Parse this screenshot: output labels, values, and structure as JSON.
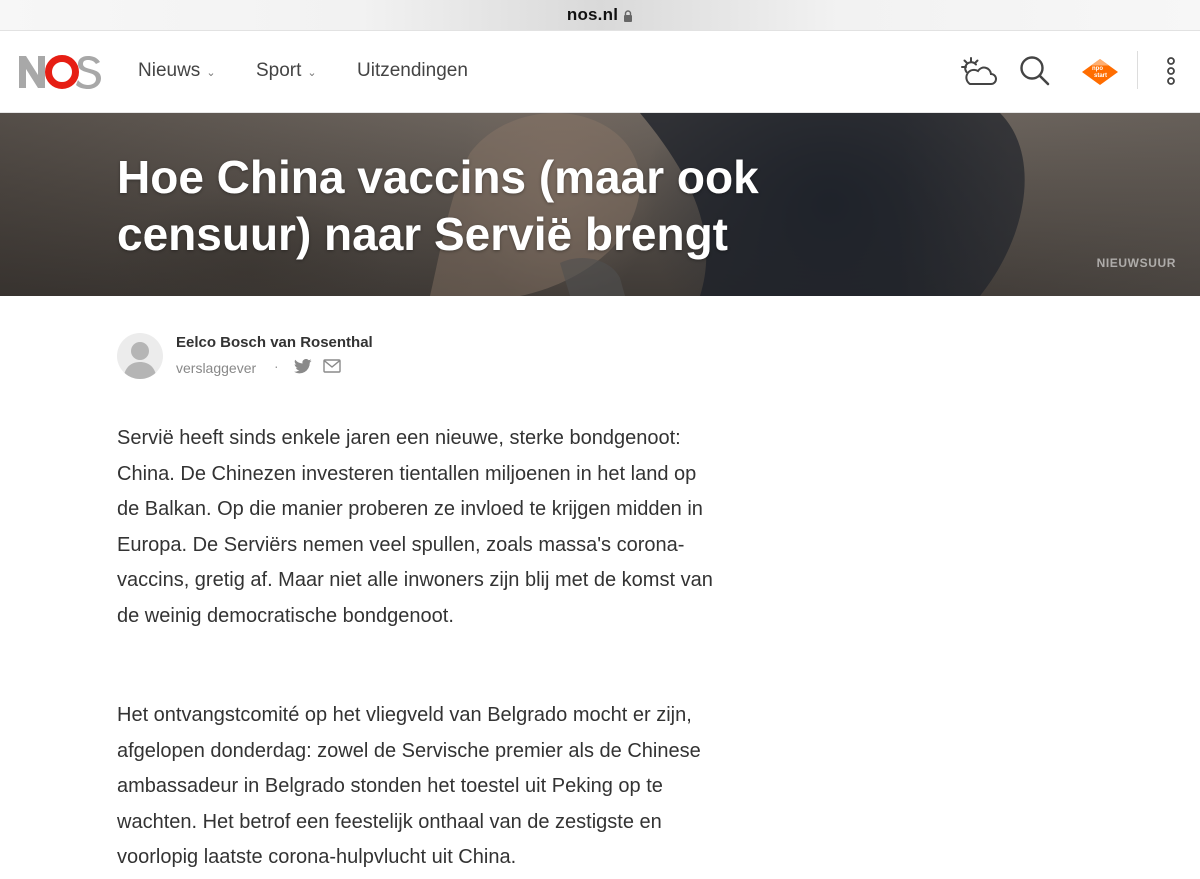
{
  "browser": {
    "url": "nos.nl"
  },
  "header": {
    "logo_text": "NOS",
    "nav": [
      {
        "label": "Nieuws",
        "has_dropdown": true
      },
      {
        "label": "Sport",
        "has_dropdown": true
      },
      {
        "label": "Uitzendingen",
        "has_dropdown": false
      }
    ],
    "icons": [
      "weather-icon",
      "search-icon",
      "npo-start-icon",
      "more-menu-icon"
    ],
    "npo_badge": {
      "top": "npo",
      "bottom": "start"
    }
  },
  "hero": {
    "title": "Hoe China vaccins (maar ook censuur) naar Servië brengt",
    "source": "NIEUWSUUR"
  },
  "author": {
    "name": "Eelco Bosch van Rosenthal",
    "role": "verslaggever",
    "separator": "·"
  },
  "article": {
    "paragraphs": [
      "Servië heeft sinds enkele jaren een nieuwe, sterke bondgenoot: China. De Chinezen investeren tientallen miljoenen in het land op de Balkan. Op die manier proberen ze invloed te krijgen midden in Europa. De Serviërs nemen veel spullen, zoals massa's corona-vaccins, gretig af. Maar niet alle inwoners zijn blij met de komst van de weinig democratische bondgenoot.",
      "Het ontvangstcomité op het vliegveld van Belgrado mocht er zijn, afgelopen donderdag: zowel de Servische premier als de Chinese ambassadeur in Belgrado stonden het toestel uit Peking op te wachten. Het betrof een feestelijk onthaal van de zestigste en voorlopig laatste corona-hulpvlucht uit China."
    ]
  },
  "colors": {
    "brand_red": "#e61e14",
    "brand_gray": "#a8a8a8",
    "npo_orange": "#ff6d00"
  }
}
